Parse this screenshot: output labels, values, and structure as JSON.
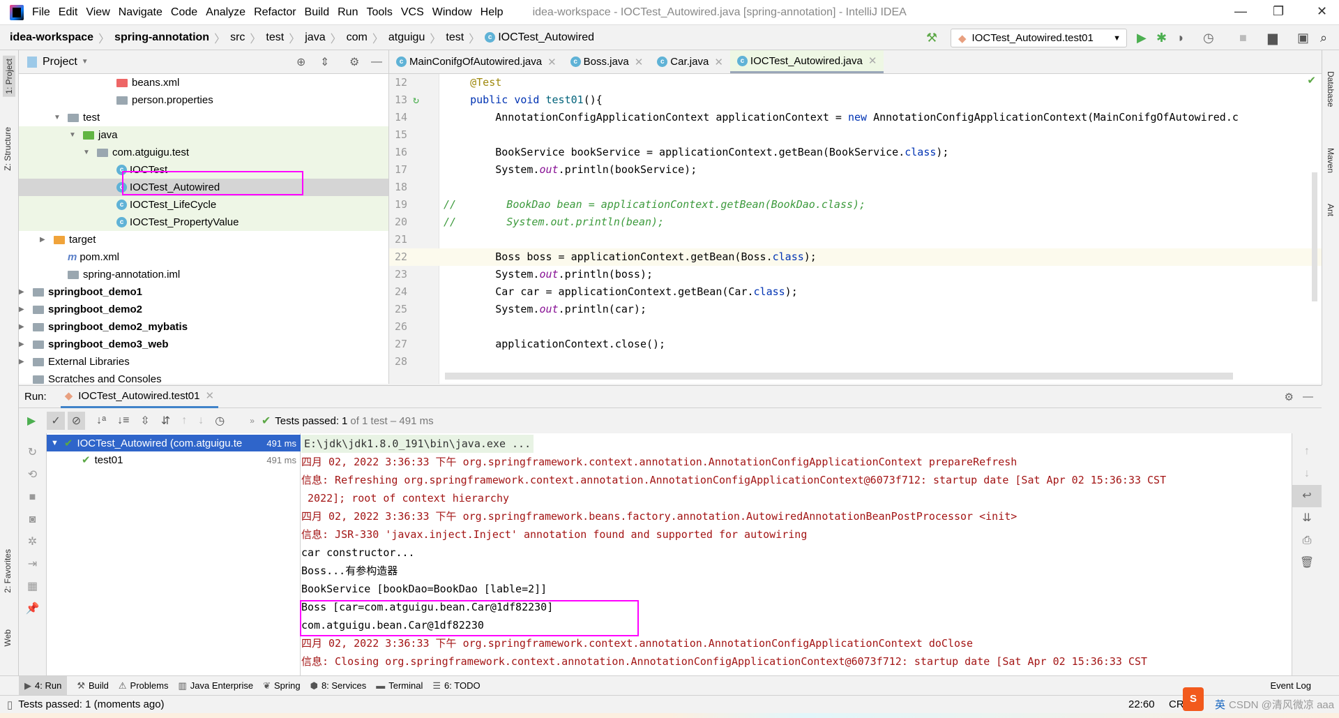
{
  "window": {
    "title": "idea-workspace - IOCTest_Autowired.java [spring-annotation] - IntelliJ IDEA",
    "menu": [
      "File",
      "Edit",
      "View",
      "Navigate",
      "Code",
      "Analyze",
      "Refactor",
      "Build",
      "Run",
      "Tools",
      "VCS",
      "Window",
      "Help"
    ]
  },
  "breadcrumb": [
    "idea-workspace",
    "spring-annotation",
    "src",
    "test",
    "java",
    "com",
    "atguigu",
    "test",
    "IOCTest_Autowired"
  ],
  "toolbar": {
    "run_config": "IOCTest_Autowired.test01"
  },
  "left_stripe": {
    "project": "1: Project",
    "structure": "Z: Structure",
    "favorites": "2: Favorites",
    "web": "Web"
  },
  "right_stripe": {
    "database": "Database",
    "maven": "Maven",
    "ant": "Ant"
  },
  "project": {
    "title": "Project",
    "tree": [
      {
        "label": "beans.xml",
        "icon": "xml-file-icon"
      },
      {
        "label": "person.properties",
        "icon": "properties-file-icon"
      },
      {
        "label": "test",
        "icon": "folder-icon"
      },
      {
        "label": "java",
        "icon": "test-source-folder-icon"
      },
      {
        "label": "com.atguigu.test",
        "icon": "package-icon"
      },
      {
        "label": "IOCTest",
        "icon": "test-class-icon"
      },
      {
        "label": "IOCTest_Autowired",
        "icon": "test-class-icon"
      },
      {
        "label": "IOCTest_LifeCycle",
        "icon": "test-class-icon"
      },
      {
        "label": "IOCTest_PropertyValue",
        "icon": "test-class-icon"
      },
      {
        "label": "target",
        "icon": "folder-icon"
      },
      {
        "label": "pom.xml",
        "icon": "maven-icon"
      },
      {
        "label": "spring-annotation.iml",
        "icon": "iml-file-icon"
      },
      {
        "label": "springboot_demo1",
        "icon": "module-icon"
      },
      {
        "label": "springboot_demo2",
        "icon": "module-icon"
      },
      {
        "label": "springboot_demo2_mybatis",
        "icon": "module-icon"
      },
      {
        "label": "springboot_demo3_web",
        "icon": "module-icon"
      },
      {
        "label": "External Libraries",
        "icon": "library-icon"
      },
      {
        "label": "Scratches and Consoles",
        "icon": "scratches-icon"
      }
    ]
  },
  "editor": {
    "tabs": [
      "MainConifgOfAutowired.java",
      "Boss.java",
      "Car.java",
      "IOCTest_Autowired.java"
    ],
    "active_tab": 3,
    "lines": [
      {
        "n": "12",
        "parts": [
          [
            "ann",
            "    @Test"
          ]
        ]
      },
      {
        "n": "13",
        "parts": [
          [
            "kw",
            "    public void "
          ],
          [
            "fn",
            "test01"
          ],
          [
            "",
            "(){"
          ]
        ]
      },
      {
        "n": "14",
        "parts": [
          [
            "",
            "        AnnotationConfigApplicationContext applicationContext = "
          ],
          [
            "kw",
            "new "
          ],
          [
            "",
            "AnnotationConfigApplicationContext(MainConifgOfAutowired.c"
          ]
        ]
      },
      {
        "n": "15",
        "parts": []
      },
      {
        "n": "16",
        "parts": [
          [
            "",
            "        BookService bookService = applicationContext.getBean(BookService."
          ],
          [
            "kw",
            "class"
          ],
          [
            "",
            ");"
          ]
        ]
      },
      {
        "n": "17",
        "parts": [
          [
            "",
            "        System."
          ],
          [
            "it",
            "out"
          ],
          [
            "",
            ".println(bookService);"
          ]
        ]
      },
      {
        "n": "18",
        "parts": []
      },
      {
        "n": "19",
        "parts": [
          [
            "cm",
            "//        BookDao bean = applicationContext.getBean(BookDao.class);"
          ]
        ]
      },
      {
        "n": "20",
        "parts": [
          [
            "cm",
            "//        System.out.println(bean);"
          ]
        ]
      },
      {
        "n": "21",
        "parts": []
      },
      {
        "n": "22",
        "parts": [
          [
            "",
            "        Boss boss = applicationContext.getBean(Boss."
          ],
          [
            "kw",
            "class"
          ],
          [
            "",
            ");"
          ]
        ]
      },
      {
        "n": "23",
        "parts": [
          [
            "",
            "        System."
          ],
          [
            "it",
            "out"
          ],
          [
            "",
            ".println(boss);"
          ]
        ]
      },
      {
        "n": "24",
        "parts": [
          [
            "",
            "        Car car = applicationContext.getBean(Car."
          ],
          [
            "kw",
            "class"
          ],
          [
            "",
            ");"
          ]
        ]
      },
      {
        "n": "25",
        "parts": [
          [
            "",
            "        System."
          ],
          [
            "it",
            "out"
          ],
          [
            "",
            ".println(car);"
          ]
        ]
      },
      {
        "n": "26",
        "parts": []
      },
      {
        "n": "27",
        "parts": [
          [
            "",
            "        applicationContext.close();"
          ]
        ]
      },
      {
        "n": "28",
        "parts": []
      }
    ]
  },
  "run": {
    "label": "Run:",
    "tab": "IOCTest_Autowired.test01",
    "status_prefix": "Tests passed:",
    "status_count": "1",
    "status_rest": "of 1 test – 491 ms",
    "tests": [
      {
        "label": "IOCTest_Autowired (com.atguigu.te",
        "time": "491 ms"
      },
      {
        "label": "test01",
        "time": "491 ms"
      }
    ],
    "console": [
      {
        "type": "cmd",
        "text": "E:\\jdk\\jdk1.8.0_191\\bin\\java.exe ..."
      },
      {
        "type": "red",
        "text": "四月 02, 2022 3:36:33 下午 org.springframework.context.annotation.AnnotationConfigApplicationContext prepareRefresh"
      },
      {
        "type": "red",
        "text": "信息: Refreshing org.springframework.context.annotation.AnnotationConfigApplicationContext@6073f712: startup date [Sat Apr 02 15:36:33 CST"
      },
      {
        "type": "red",
        "text": " 2022]; root of context hierarchy"
      },
      {
        "type": "red",
        "text": "四月 02, 2022 3:36:33 下午 org.springframework.beans.factory.annotation.AutowiredAnnotationBeanPostProcessor <init>"
      },
      {
        "type": "red",
        "text": "信息: JSR-330 'javax.inject.Inject' annotation found and supported for autowiring"
      },
      {
        "type": "out",
        "text": "car constructor..."
      },
      {
        "type": "out",
        "text": "Boss...有参构造器"
      },
      {
        "type": "out",
        "text": "BookService [bookDao=BookDao [lable=2]]"
      },
      {
        "type": "out",
        "text": "Boss [car=com.atguigu.bean.Car@1df82230]"
      },
      {
        "type": "out",
        "text": "com.atguigu.bean.Car@1df82230"
      },
      {
        "type": "red",
        "text": "四月 02, 2022 3:36:33 下午 org.springframework.context.annotation.AnnotationConfigApplicationContext doClose"
      },
      {
        "type": "red",
        "text": "信息: Closing org.springframework.context.annotation.AnnotationConfigApplicationContext@6073f712: startup date [Sat Apr 02 15:36:33 CST"
      }
    ]
  },
  "bottom_tools": [
    "4: Run",
    "Build",
    "Problems",
    "Java Enterprise",
    "Spring",
    "8: Services",
    "Terminal",
    "6: TODO"
  ],
  "event_log": "Event Log",
  "status": {
    "text": "Tests passed: 1 (moments ago)",
    "position": "22:60",
    "line_sep": "CRLF",
    "watermark": "CSDN @清风微凉 aaa",
    "ime": "英"
  },
  "colors": {
    "selection": "#2f65ca",
    "highlight_box": "#ff00ff",
    "pass": "#5ba745",
    "console_red": "#a31515"
  }
}
